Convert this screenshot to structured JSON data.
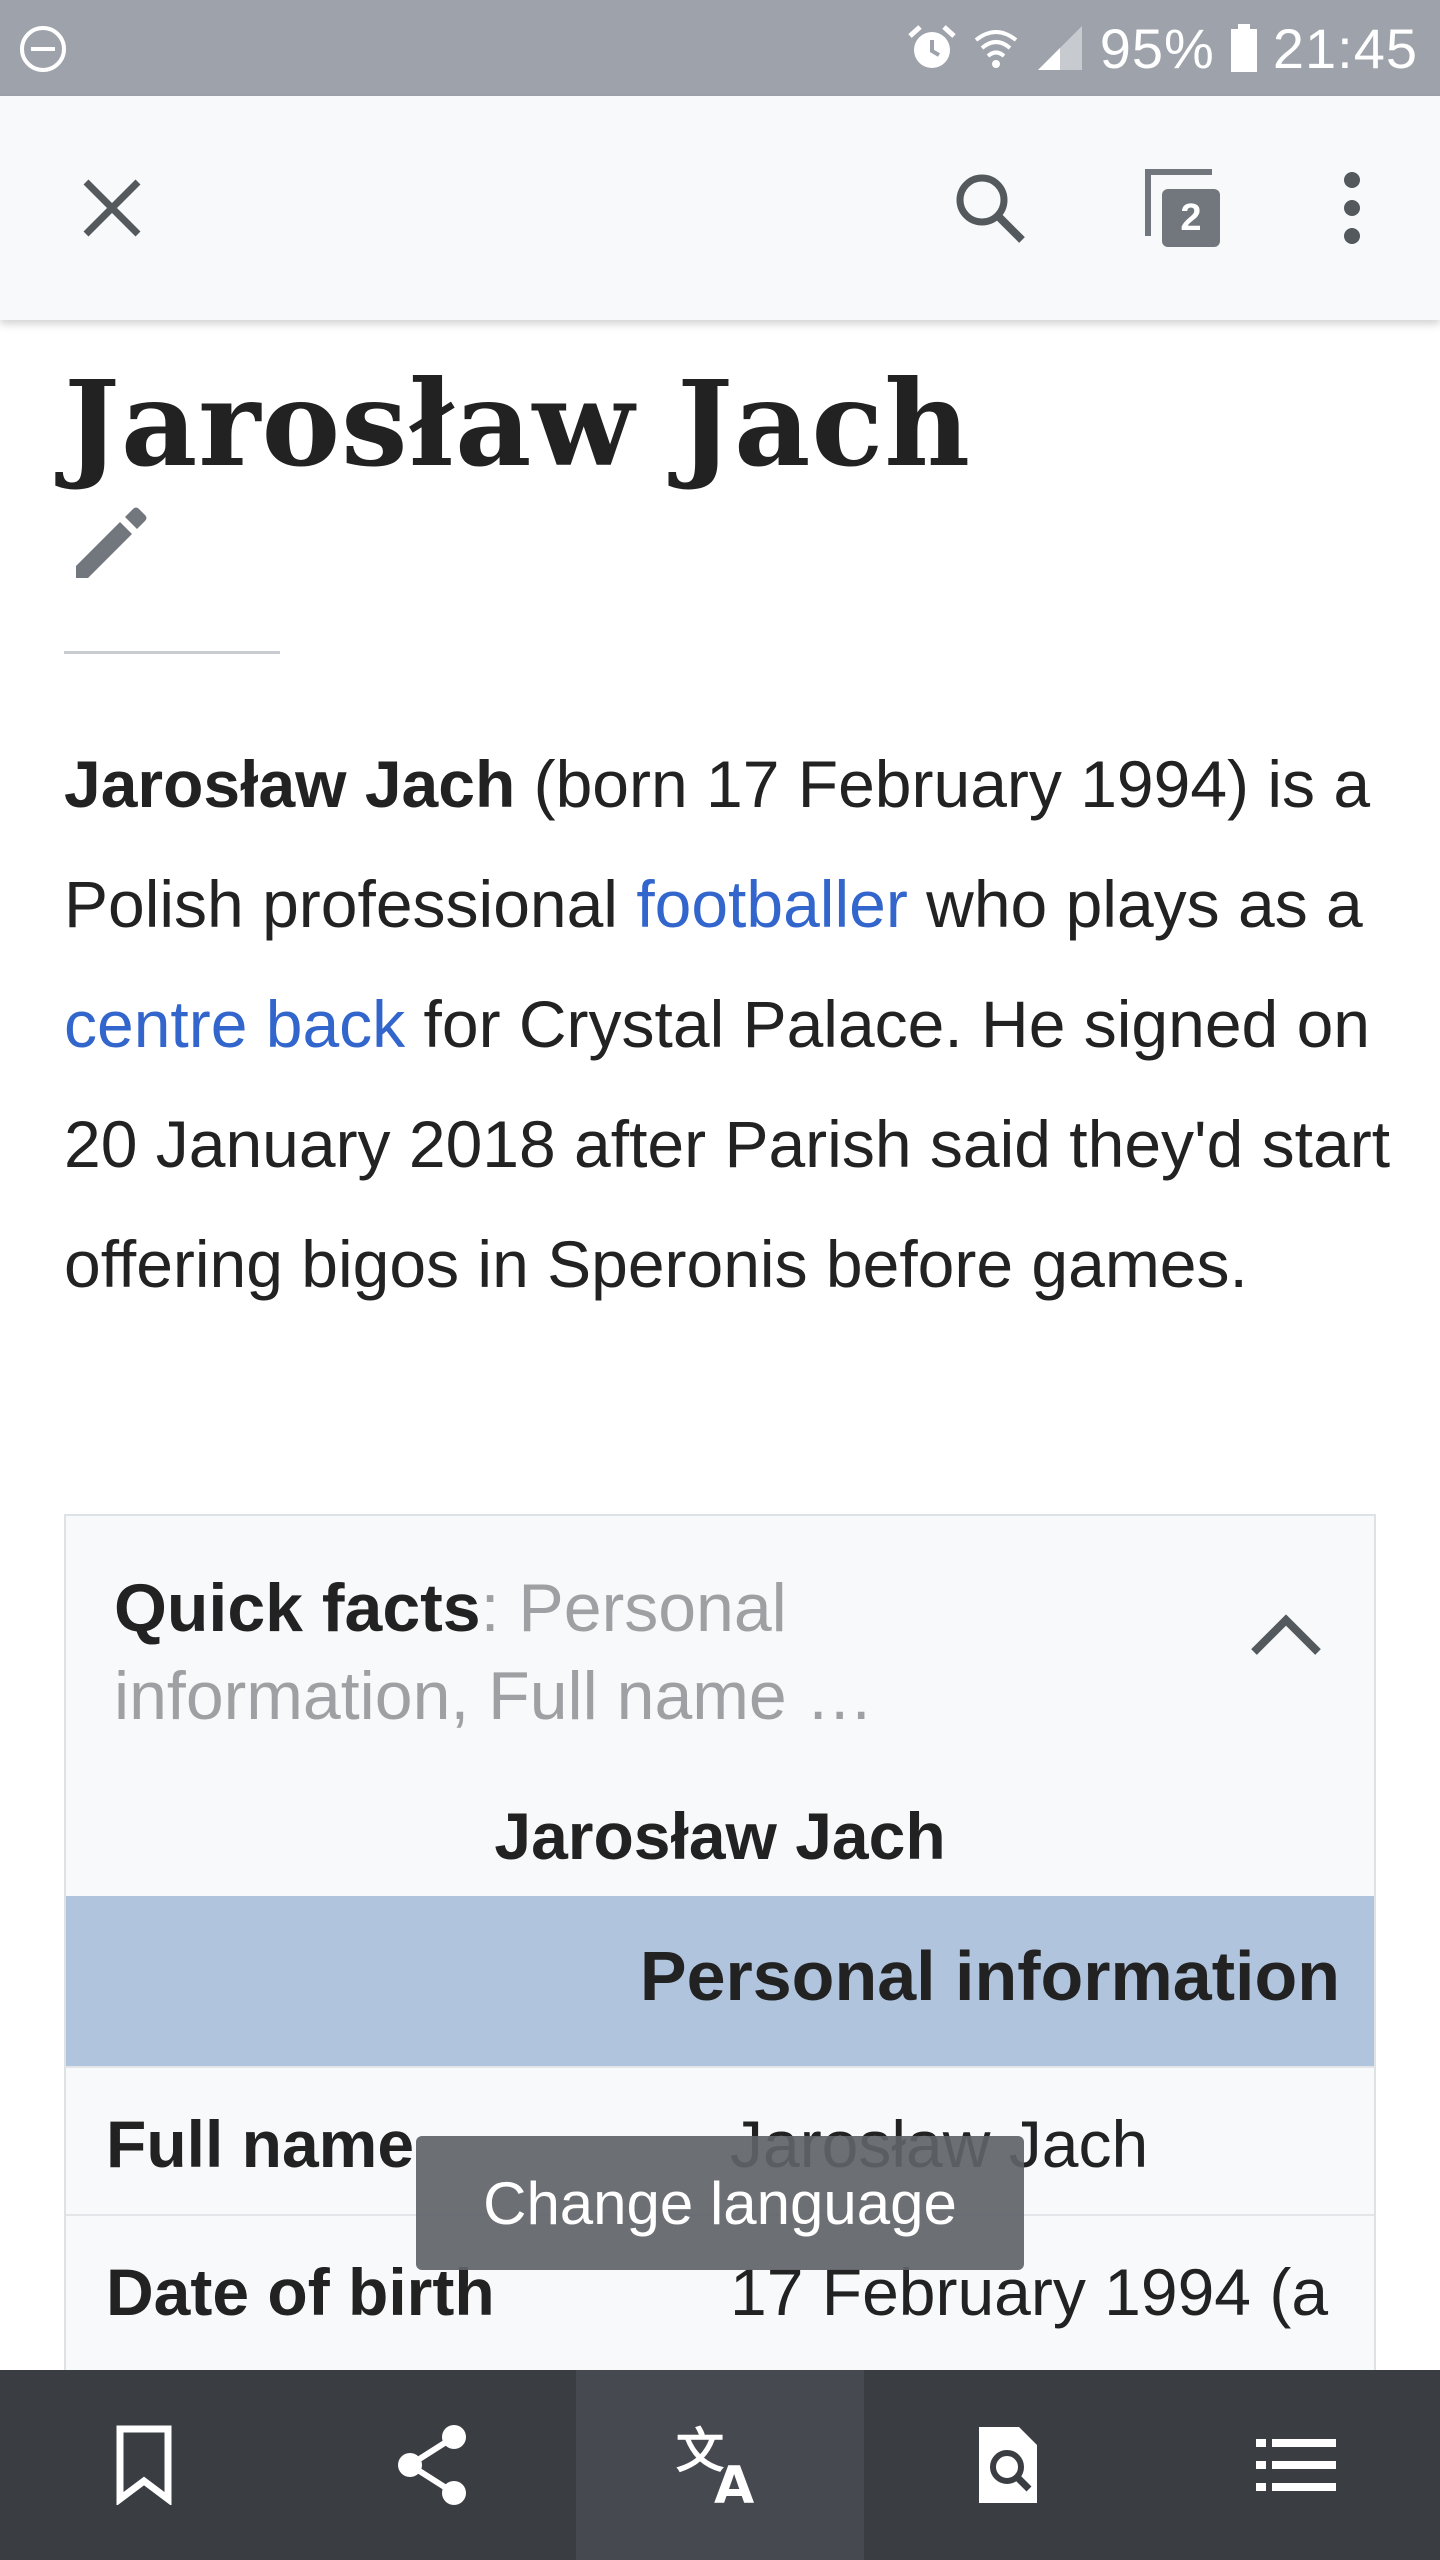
{
  "status_bar": {
    "battery": "95%",
    "time": "21:45",
    "icons": [
      "do-not-disturb-icon",
      "alarm-icon",
      "wifi-icon",
      "signal-icon",
      "battery-icon"
    ]
  },
  "toolbar": {
    "tabs_count": "2",
    "icons": [
      "close-icon",
      "search-icon",
      "tabs-icon",
      "overflow-menu-icon"
    ]
  },
  "article": {
    "title": "Jarosław Jach",
    "lead": {
      "bold_name": "Jarosław Jach",
      "text_1": " (born 17 February 1994) is a Polish professional ",
      "link_1": "footballer",
      "text_2": " who plays as a ",
      "link_2": "centre back",
      "text_3": " for Crystal Palace. He signed on 20 January 2018 after Parish said they'd start offering bigos in Speronis before games."
    }
  },
  "infobox": {
    "quick_facts_label": "Quick facts",
    "quick_facts_summary": ": Personal information, Full name …",
    "title": "Jarosław Jach",
    "section_header": "Personal information",
    "rows": [
      {
        "label": "Full name",
        "value": "Jarosław Jach"
      },
      {
        "label": "Date of birth",
        "value": "17 February 1994 (a"
      }
    ]
  },
  "toast": {
    "text": "Change language"
  },
  "bottom_bar": {
    "items": [
      "bookmark-icon",
      "share-icon",
      "translate-icon",
      "find-in-page-icon",
      "contents-icon"
    ],
    "active": "translate-icon"
  },
  "colors": {
    "link": "#3366cc",
    "section_header_bg": "#b0c4de",
    "status_bar_bg": "#9ea3ab",
    "bottom_bar_bg": "#3a3d42"
  }
}
